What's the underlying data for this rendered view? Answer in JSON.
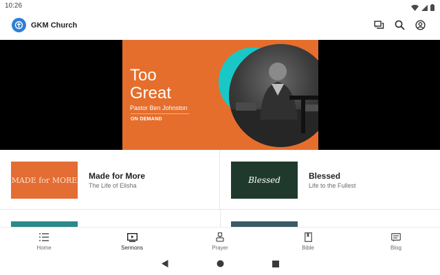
{
  "status_bar": {
    "time": "10:26",
    "icons": [
      "wifi-icon",
      "signal-icon",
      "battery-icon"
    ]
  },
  "app_bar": {
    "title": "GKM Church",
    "logo_icon": "church-logo-icon",
    "actions": [
      "chat-icon",
      "search-icon",
      "account-icon"
    ]
  },
  "hero": {
    "title_line1": "Too",
    "title_line2": "Great",
    "speaker": "Pastor Ben Johnston",
    "badge": "ON DEMAND"
  },
  "series": [
    {
      "thumb_text": "MADE for MORE",
      "title": "Made for More",
      "subtitle": "The Life of Elisha"
    },
    {
      "thumb_text": "Blessed",
      "title": "Blessed",
      "subtitle": "Life to the Fullest"
    }
  ],
  "bottom_nav": {
    "items": [
      {
        "label": "Home",
        "icon": "list-icon",
        "active": false
      },
      {
        "label": "Sermons",
        "icon": "play-screen-icon",
        "active": true
      },
      {
        "label": "Prayer",
        "icon": "prayer-icon",
        "active": false
      },
      {
        "label": "Bible",
        "icon": "book-icon",
        "active": false
      },
      {
        "label": "Blog",
        "icon": "blog-icon",
        "active": false
      }
    ]
  },
  "colors": {
    "accent": "#2d7fd3",
    "hero_orange": "#e56e2c",
    "hero_teal": "#19c8c6"
  }
}
